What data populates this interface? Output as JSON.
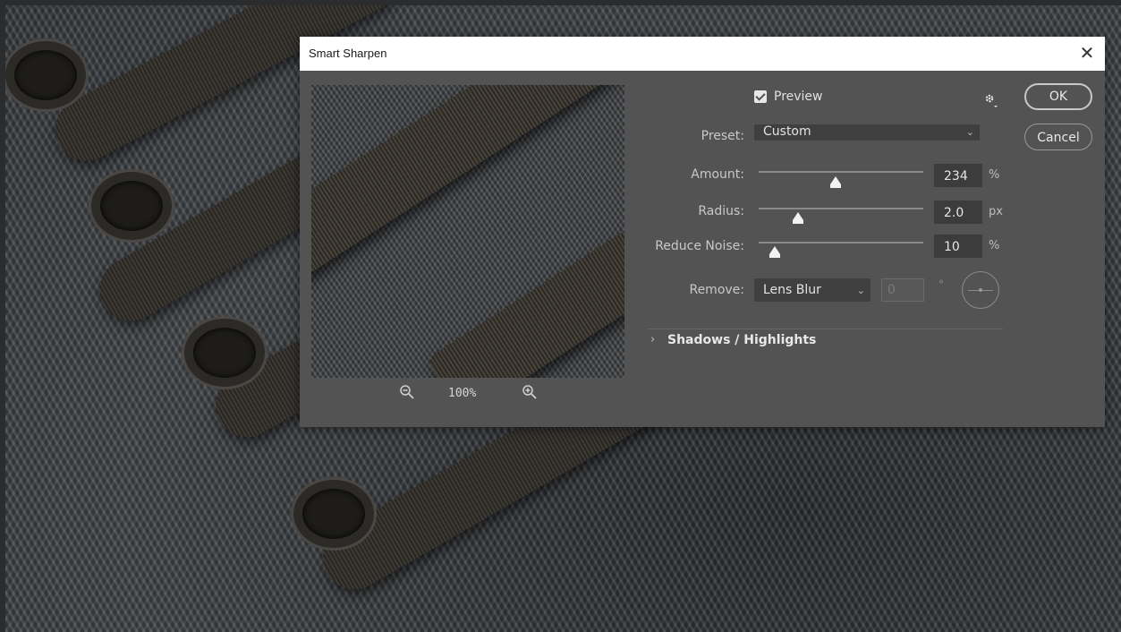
{
  "dialog": {
    "title": "Smart Sharpen",
    "close_icon": "close-icon"
  },
  "preview_panel": {
    "zoom_out_icon": "zoom-out-icon",
    "zoom_in_icon": "zoom-in-icon",
    "zoom_level": "100%"
  },
  "controls": {
    "preview_label": "Preview",
    "preview_checked": true,
    "settings_icon": "gear-icon",
    "preset_label": "Preset:",
    "preset_value": "Custom",
    "amount_label": "Amount:",
    "amount_value": "234",
    "amount_unit": "%",
    "radius_label": "Radius:",
    "radius_value": "2.0",
    "radius_unit": "px",
    "noise_label": "Reduce Noise:",
    "noise_value": "10",
    "noise_unit": "%",
    "remove_label": "Remove:",
    "remove_value": "Lens Blur",
    "angle_value": "0",
    "angle_unit": "°"
  },
  "section": {
    "title": "Shadows / Highlights",
    "expanded": false
  },
  "buttons": {
    "ok": "OK",
    "cancel": "Cancel"
  },
  "colors": {
    "dialog_bg": "#535353",
    "titlebar_bg": "#ffffff",
    "field_bg": "#3c3c3c"
  }
}
